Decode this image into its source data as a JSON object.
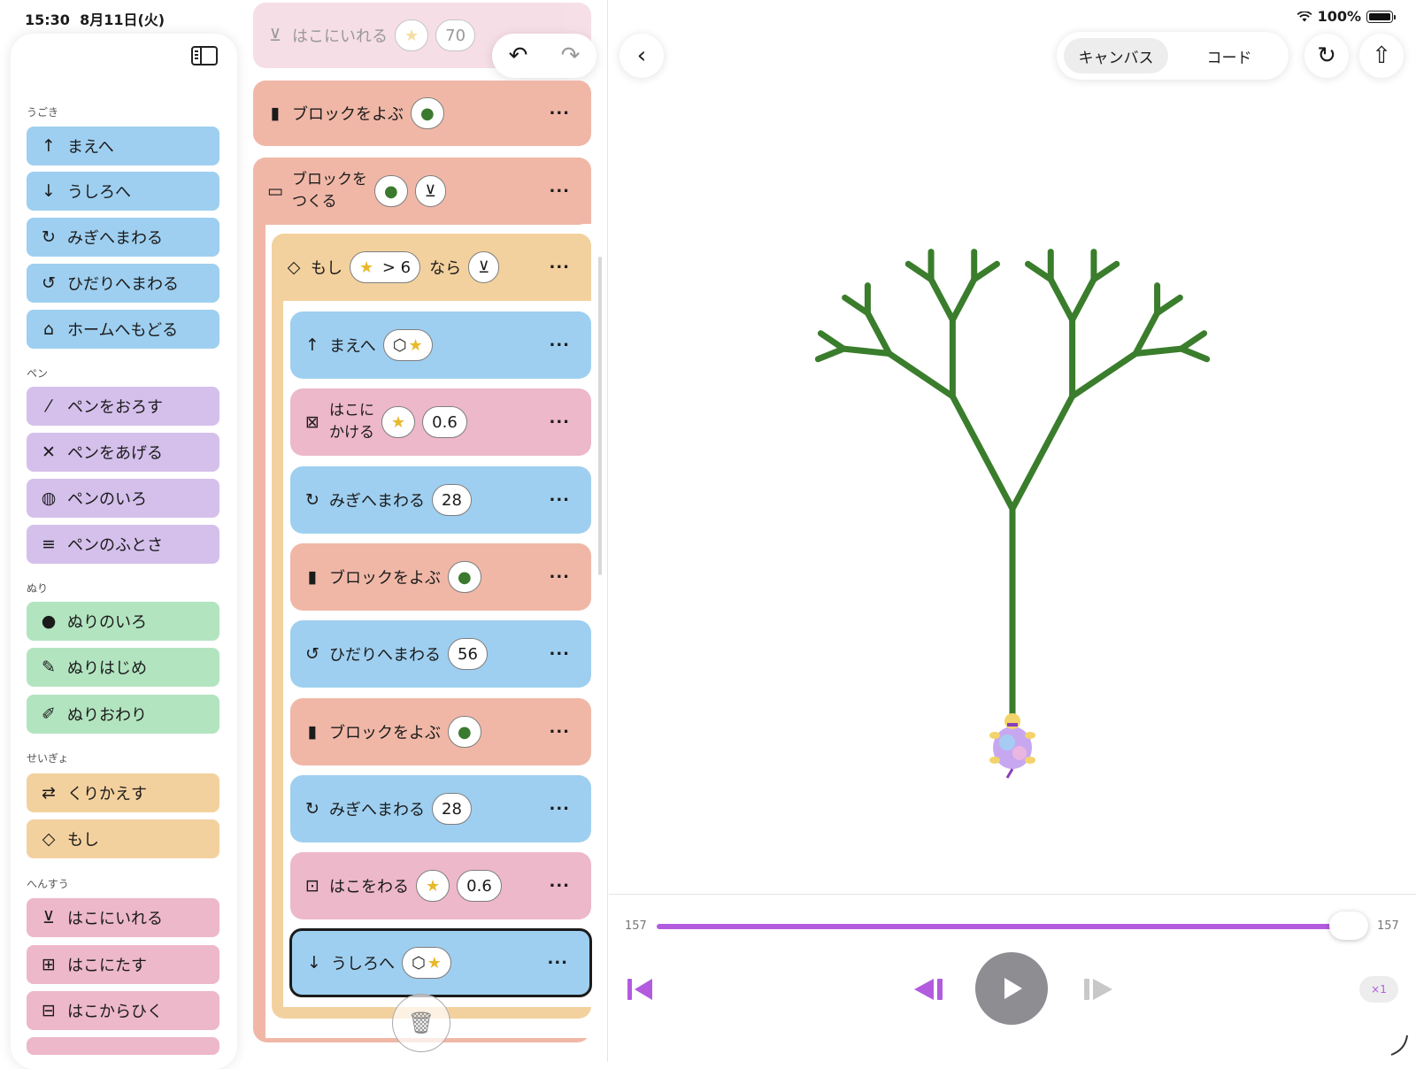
{
  "status": {
    "time": "15:30",
    "date": "8月11日(火)",
    "battery": "100%"
  },
  "palette": {
    "sections": {
      "motion": "うごき",
      "pen": "ペン",
      "fill": "ぬり",
      "control": "せいぎょ",
      "vars": "へんすう"
    },
    "items": {
      "forward": "まえへ",
      "backward": "うしろへ",
      "turn_right": "みぎへまわる",
      "turn_left": "ひだりへまわる",
      "home": "ホームへもどる",
      "pen_down": "ペンをおろす",
      "pen_up": "ペンをあげる",
      "pen_color": "ペンのいろ",
      "pen_width": "ペンのふとさ",
      "fill_color": "ぬりのいろ",
      "fill_start": "ぬりはじめ",
      "fill_end": "ぬりおわり",
      "repeat": "くりかえす",
      "if": "もし",
      "set_box": "はこにいれる",
      "add_box": "はこにたす",
      "sub_box": "はこからひく"
    }
  },
  "code": {
    "top_block": {
      "label": "はこにいれる",
      "value": "70"
    },
    "call_block_1": {
      "label": "ブロックをよぶ"
    },
    "define_block": {
      "line1": "ブロックを",
      "line2": "つくる"
    },
    "if_block": {
      "label": "もし",
      "condition": "> 6",
      "then": "なら"
    },
    "forward_block": {
      "label": "まえへ"
    },
    "mul_block": {
      "line1": "はこに",
      "line2": "かける",
      "value": "0.6"
    },
    "turn_right_1": {
      "label": "みぎへまわる",
      "value": "28"
    },
    "call_block_2": {
      "label": "ブロックをよぶ"
    },
    "turn_left": {
      "label": "ひだりへまわる",
      "value": "56"
    },
    "call_block_3": {
      "label": "ブロックをよぶ"
    },
    "turn_right_2": {
      "label": "みぎへまわる",
      "value": "28"
    },
    "div_block": {
      "label": "はこをわる",
      "value": "0.6"
    },
    "backward_block": {
      "label": "うしろへ"
    }
  },
  "toolbar": {
    "canvas_tab": "キャンバス",
    "code_tab": "コード"
  },
  "player": {
    "step_start": "157",
    "step_end": "157",
    "progress": 1.0,
    "speed": "×1"
  },
  "colors": {
    "tree_stroke": "#3a7d2c",
    "accent": "#b35bdf"
  }
}
